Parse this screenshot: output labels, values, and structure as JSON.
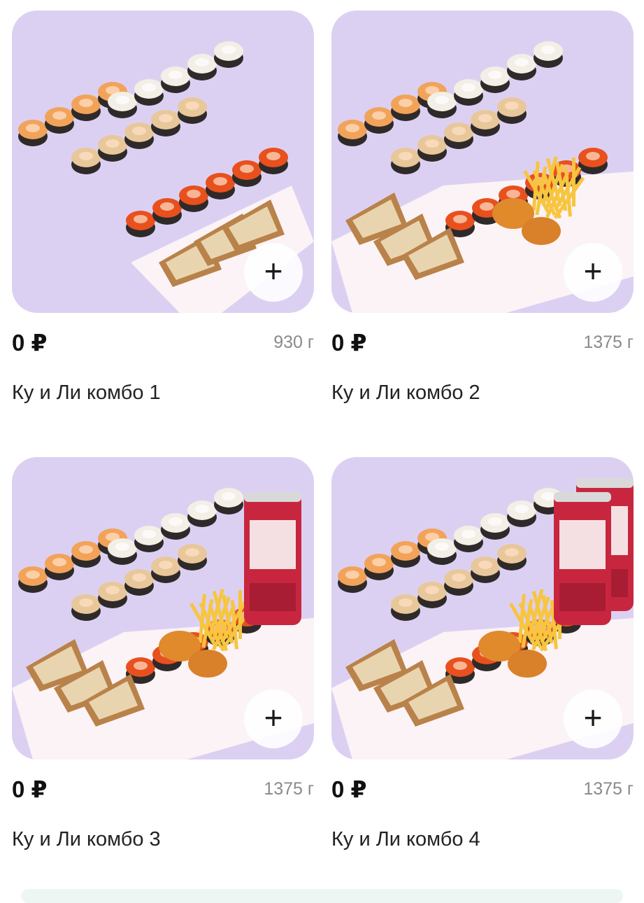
{
  "products": [
    {
      "price": "0 ₽",
      "weight": "930 г",
      "name": "Ку и Ли комбо 1",
      "add_label": "+",
      "drink": false,
      "fries": false,
      "two_cans": false
    },
    {
      "price": "0 ₽",
      "weight": "1375 г",
      "name": "Ку и Ли комбо 2",
      "add_label": "+",
      "drink": false,
      "fries": true,
      "two_cans": false
    },
    {
      "price": "0 ₽",
      "weight": "1375 г",
      "name": "Ку и Ли комбо 3",
      "add_label": "+",
      "drink": true,
      "fries": true,
      "two_cans": false
    },
    {
      "price": "0 ₽",
      "weight": "1375 г",
      "name": "Ку и Ли комбо 4",
      "add_label": "+",
      "drink": true,
      "fries": true,
      "two_cans": true
    }
  ],
  "colors": {
    "card_bg": "#dcd0f2",
    "salmon_roll": "#f08a3e",
    "rice": "#f3efe6",
    "tobiko": "#e8501e",
    "can_red": "#c8263f"
  }
}
